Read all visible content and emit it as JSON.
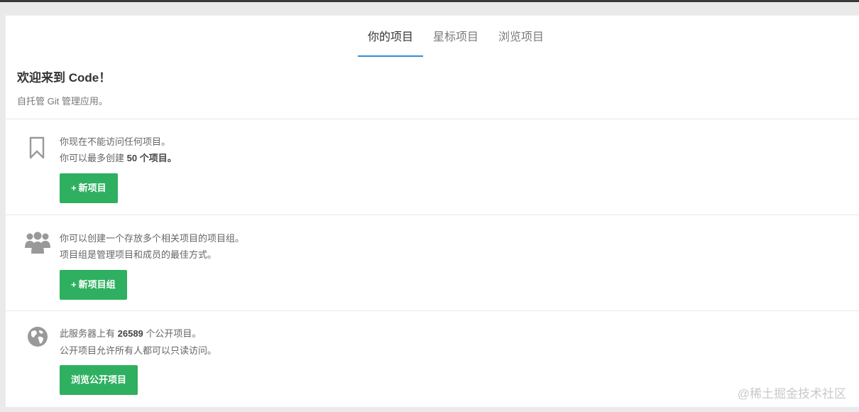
{
  "tabs": [
    "你的项目",
    "星标项目",
    "浏览项目"
  ],
  "welcome": {
    "title": "欢迎来到 Code！",
    "subtitle": "自托管 Git 管理应用。"
  },
  "projects_block": {
    "line1": "你现在不能访问任何项目。",
    "line2_prefix": "你可以最多创建 ",
    "line2_bold": "50 个项目。",
    "button_icon": "+",
    "button_label": "新项目"
  },
  "groups_block": {
    "line1": "你可以创建一个存放多个相关项目的项目组。",
    "line2": "项目组是管理项目和成员的最佳方式。",
    "button_icon": "+",
    "button_label": "新项目组"
  },
  "public_block": {
    "line1_prefix": "此服务器上有 ",
    "line1_bold": "26589",
    "line1_suffix": " 个公开项目。",
    "line2": "公开项目允许所有人都可以只读访问。",
    "button_label": "浏览公开项目"
  },
  "watermark": "@稀土掘金技术社区",
  "colors": {
    "accent_tab": "#2f8fd6",
    "button_green": "#2fb060",
    "icon_gray": "#999999"
  },
  "icons": [
    "bookmark-icon",
    "users-icon",
    "globe-icon"
  ]
}
